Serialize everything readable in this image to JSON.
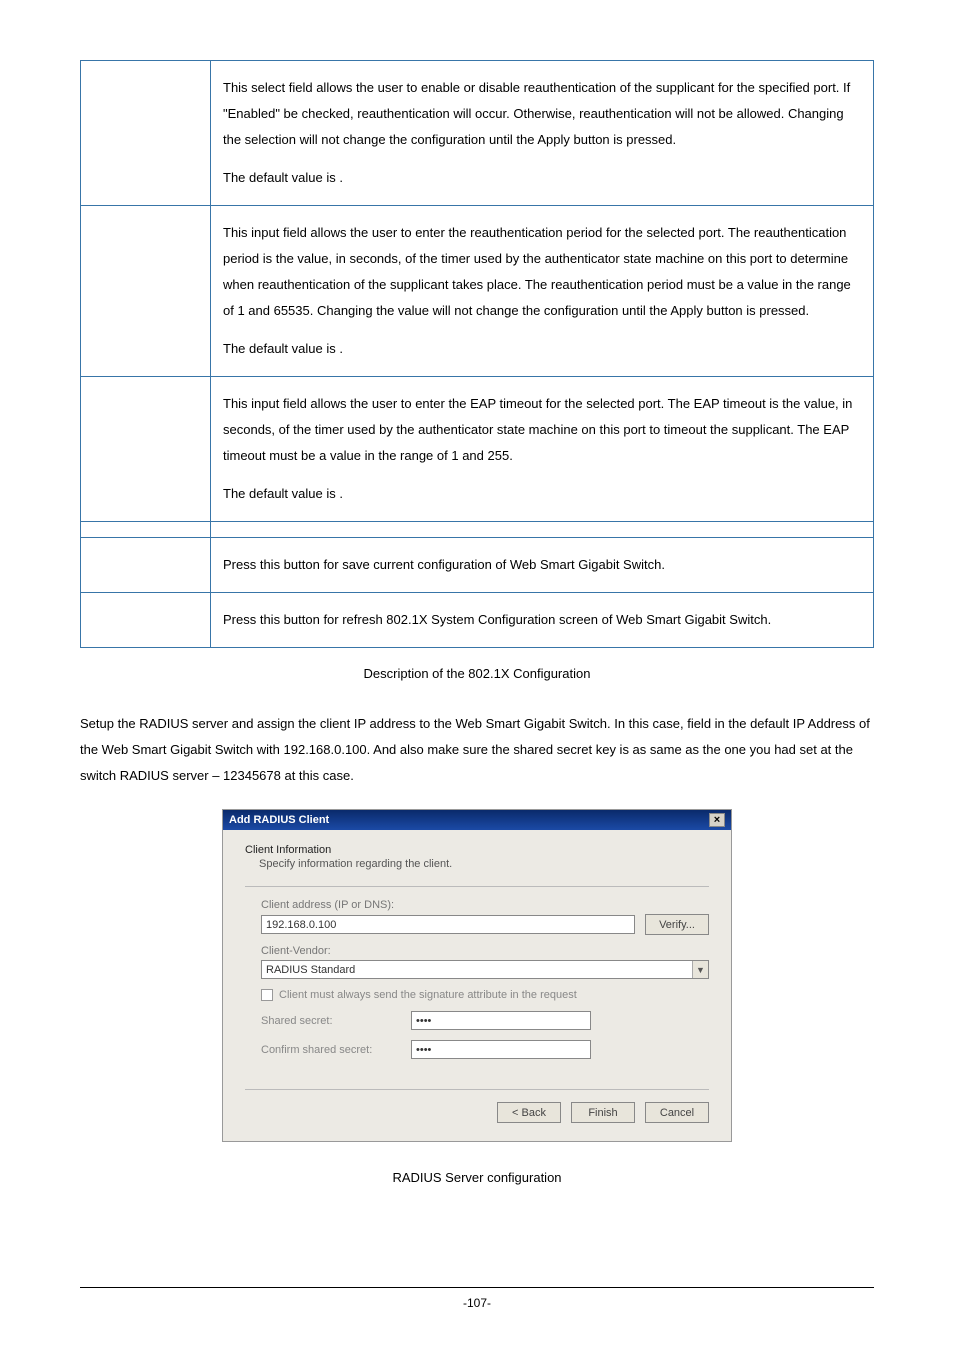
{
  "table": {
    "rows": [
      {
        "label": "",
        "desc": "This select field allows the user to enable or disable reauthentication of the supplicant for the specified port. If \"Enabled\" be checked, reauthentication will occur. Otherwise, reauthentication will not be allowed. Changing the selection will not change the configuration until the Apply button is pressed.",
        "default": "The default value is                         ."
      },
      {
        "label": "",
        "desc": "This input field allows the user to enter the reauthentication period for the selected port. The reauthentication period is the value, in seconds, of the timer used by the authenticator state machine on this port to determine when reauthentication of the supplicant takes place. The reauthentication period must be a value in the range of 1 and 65535. Changing the value will not change the configuration until the Apply button is pressed.",
        "default": "The default value is            ."
      },
      {
        "label": "",
        "desc": "This input field allows the user to enter the EAP timeout for the selected port. The EAP timeout is the value, in seconds, of the timer used by the authenticator state machine on this port to timeout the supplicant. The EAP timeout must be a value in the range of 1 and 255.",
        "default": "The default value is     ."
      }
    ],
    "buttons": [
      {
        "label": "",
        "desc": "Press this button for save current configuration of Web Smart Gigabit Switch."
      },
      {
        "label": "",
        "desc": "Press this button for refresh 802.1X System Configuration screen of Web Smart Gigabit Switch."
      }
    ]
  },
  "captions": {
    "table_caption": "Description of the 802.1X Configuration",
    "figure_caption": "RADIUS Server configuration"
  },
  "paragraph": "Setup the RADIUS server and assign the client IP address to the Web Smart Gigabit Switch. In this case, field in the default IP Address of the Web Smart Gigabit Switch with 192.168.0.100. And also make sure the shared secret key is as same as the one you had set at the switch RADIUS server – 12345678 at this case.",
  "dialog": {
    "title": "Add RADIUS Client",
    "heading": "Client Information",
    "subheading": "Specify information regarding the client.",
    "client_address_label": "Client address (IP or DNS):",
    "client_address_value": "192.168.0.100",
    "verify_label": "Verify...",
    "client_vendor_label": "Client-Vendor:",
    "client_vendor_value": "RADIUS Standard",
    "checkbox_label": "Client must always send the signature attribute in the request",
    "shared_secret_label": "Shared secret:",
    "shared_secret_value": "••••",
    "confirm_secret_label": "Confirm shared secret:",
    "confirm_secret_value": "••••",
    "back_label": "< Back",
    "finish_label": "Finish",
    "cancel_label": "Cancel"
  },
  "page_number": "-107-"
}
